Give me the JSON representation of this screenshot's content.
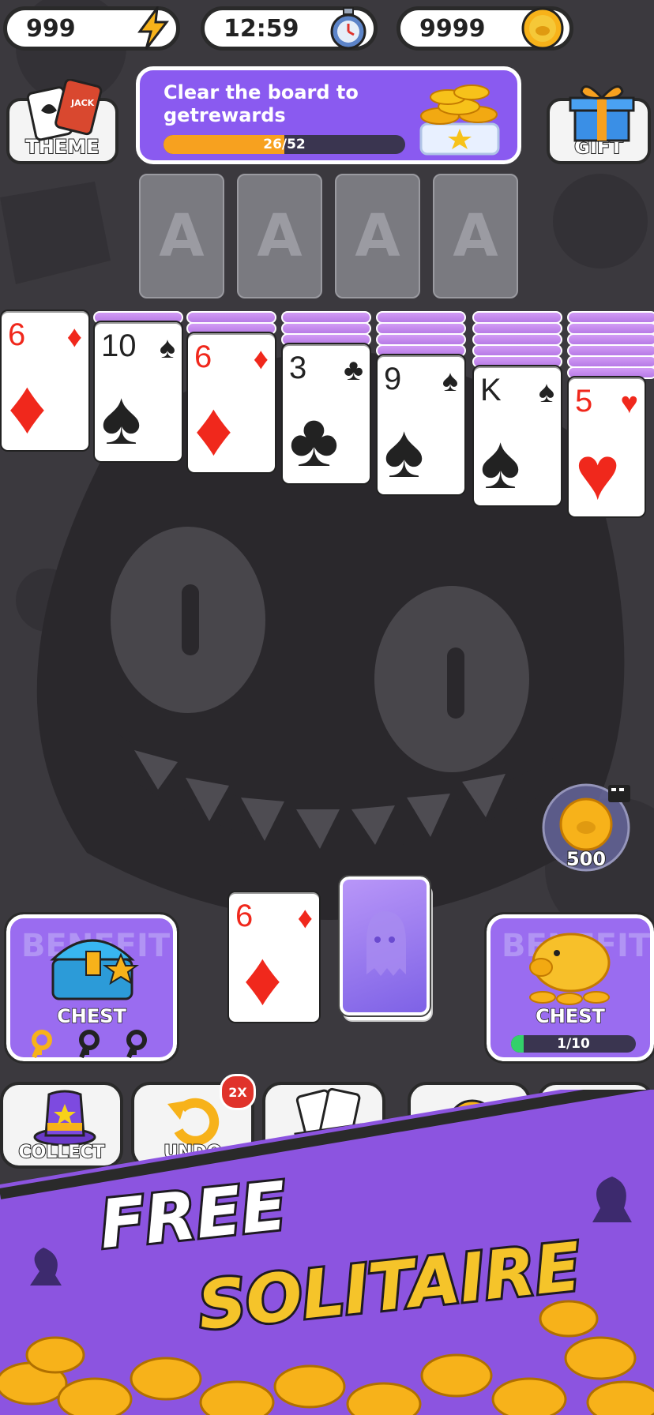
{
  "status_bar": {
    "energy": "999",
    "timer": "12:59",
    "coins": "9999"
  },
  "theme_button": {
    "label": "THEME",
    "card_text": "JACK"
  },
  "gift_button": {
    "label": "GIFT"
  },
  "reward_banner": {
    "text": "Clear the board to getrewards",
    "progress_text": "26/52",
    "progress_fraction": 0.5
  },
  "foundations": [
    "A",
    "A",
    "A",
    "A"
  ],
  "tableau": [
    {
      "rank": "6",
      "suit": "♦",
      "color": "red",
      "hidden": 0
    },
    {
      "rank": "10",
      "suit": "♠",
      "color": "black",
      "hidden": 1
    },
    {
      "rank": "6",
      "suit": "♦",
      "color": "red",
      "hidden": 2
    },
    {
      "rank": "3",
      "suit": "♣",
      "color": "black",
      "hidden": 3
    },
    {
      "rank": "9",
      "suit": "♠",
      "color": "black",
      "hidden": 4
    },
    {
      "rank": "K",
      "suit": "♠",
      "color": "black",
      "hidden": 5
    },
    {
      "rank": "5",
      "suit": "♥",
      "color": "red",
      "hidden": 6
    }
  ],
  "bonus_bubble": {
    "amount": "500"
  },
  "waste_card": {
    "rank": "6",
    "suit": "♦"
  },
  "left_chest": {
    "label": "CHEST",
    "faded": "BENEFIT"
  },
  "right_chest": {
    "label": "CHEST",
    "progress_text": "1/10",
    "progress_fraction": 0.1,
    "faded": "BENEFIT"
  },
  "toolbar": {
    "collect_label": "COLLECT",
    "undo_label": "UNDO",
    "undo_badge": "2X"
  },
  "promo": {
    "line1": "FREE",
    "line2": "SOLITAIRE"
  }
}
